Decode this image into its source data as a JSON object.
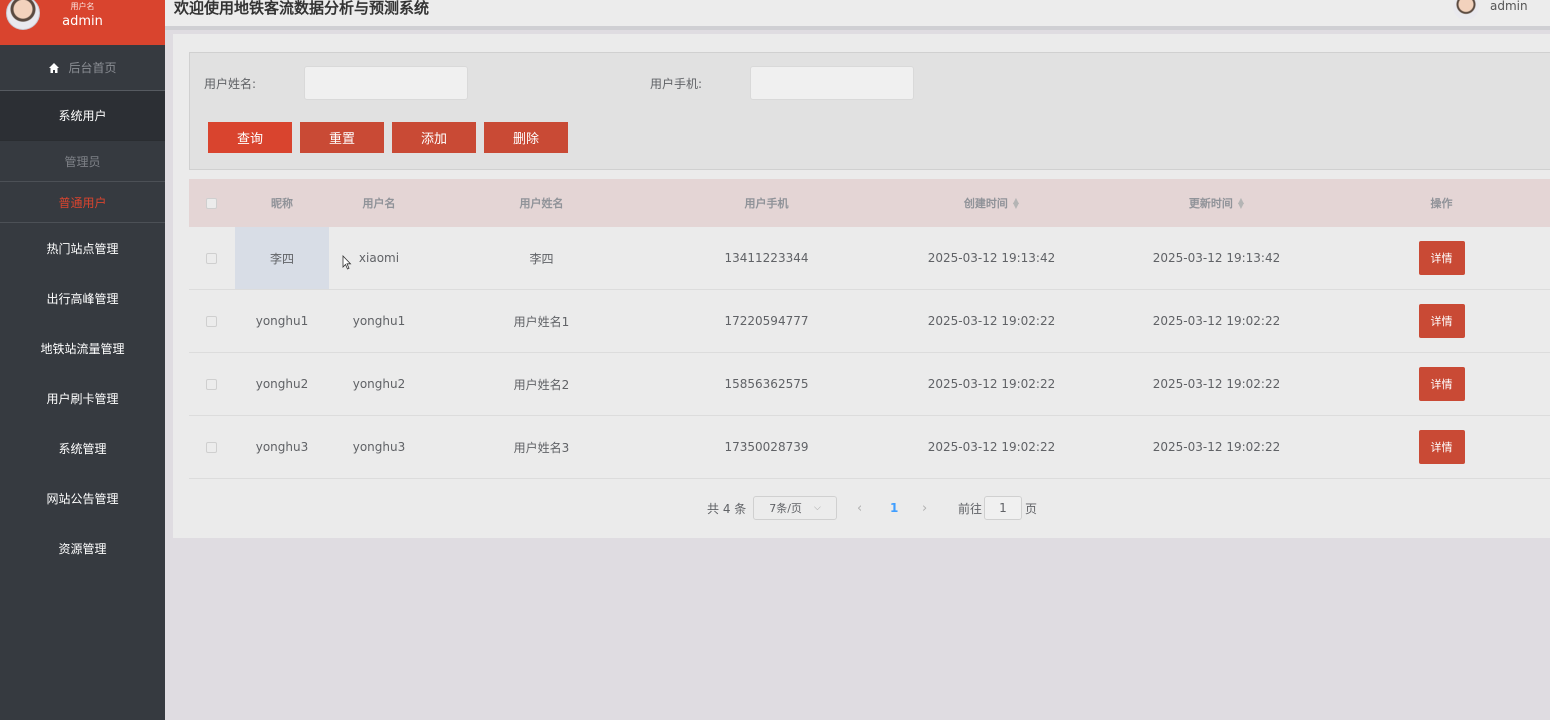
{
  "app": {
    "title": "欢迎使用地铁客流数据分析与预测系统",
    "header_user": "admin"
  },
  "sidebar": {
    "user_label": "用户名",
    "user_name": "admin",
    "home": "后台首页",
    "group": "系统用户",
    "sub_items": [
      "管理员",
      "普通用户"
    ],
    "items": [
      "热门站点管理",
      "出行高峰管理",
      "地铁站流量管理",
      "用户刷卡管理",
      "系统管理",
      "网站公告管理",
      "资源管理"
    ]
  },
  "search": {
    "name_label": "用户姓名:",
    "name_value": "",
    "phone_label": "用户手机:",
    "phone_value": ""
  },
  "buttons": {
    "query": "查询",
    "reset": "重置",
    "add": "添加",
    "delete": "删除"
  },
  "table": {
    "headers": [
      "昵称",
      "用户名",
      "用户姓名",
      "用户手机",
      "创建时间",
      "更新时间",
      "操作"
    ],
    "detail_label": "详情",
    "rows": [
      {
        "nickname": "李四",
        "username": "xiaomi",
        "realname": "李四",
        "phone": "13411223344",
        "created": "2025-03-12 19:13:42",
        "updated": "2025-03-12 19:13:42"
      },
      {
        "nickname": "yonghu1",
        "username": "yonghu1",
        "realname": "用户姓名1",
        "phone": "17220594777",
        "created": "2025-03-12 19:02:22",
        "updated": "2025-03-12 19:02:22"
      },
      {
        "nickname": "yonghu2",
        "username": "yonghu2",
        "realname": "用户姓名2",
        "phone": "15856362575",
        "created": "2025-03-12 19:02:22",
        "updated": "2025-03-12 19:02:22"
      },
      {
        "nickname": "yonghu3",
        "username": "yonghu3",
        "realname": "用户姓名3",
        "phone": "17350028739",
        "created": "2025-03-12 19:02:22",
        "updated": "2025-03-12 19:02:22"
      }
    ]
  },
  "pagination": {
    "total": "共 4 条",
    "page_size": "7条/页",
    "current": "1",
    "goto_label": "前往",
    "goto_value": "1",
    "page_suffix": "页"
  },
  "colors": {
    "accent": "#d9442e",
    "sidebar_bg": "#363a40",
    "table_header_bg": "#e4d5d5",
    "pager_active": "#409eff"
  }
}
